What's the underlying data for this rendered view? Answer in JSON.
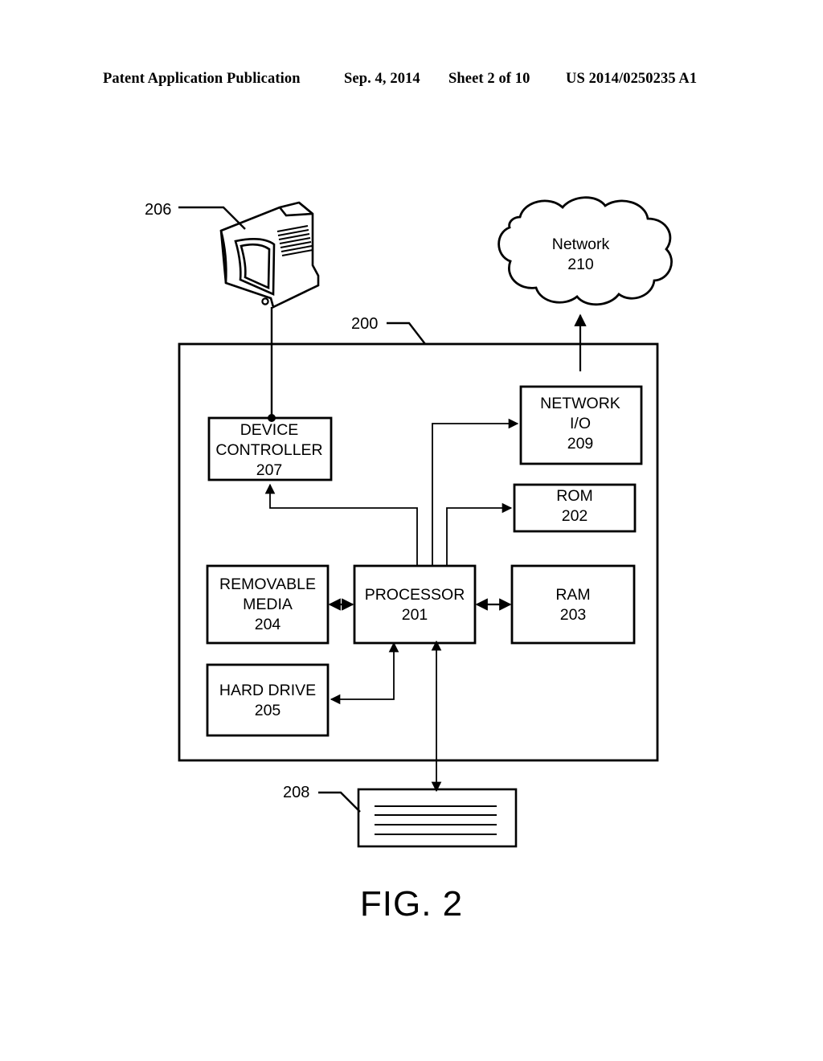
{
  "header": {
    "publication": "Patent Application Publication",
    "date": "Sep. 4, 2014",
    "sheet": "Sheet 2 of 10",
    "patent_number": "US 2014/0250235 A1"
  },
  "figure": {
    "caption": "FIG. 2",
    "system_ref": "200",
    "display_ref": "206",
    "input_device_ref": "208",
    "cloud": {
      "name": "Network",
      "ref": "210",
      "label": "Network\n210"
    },
    "blocks": [
      {
        "id": "device-controller",
        "name": "DEVICE CONTROLLER",
        "ref": "207",
        "label": "DEVICE\nCONTROLLER\n207"
      },
      {
        "id": "network-io",
        "name": "NETWORK I/O",
        "ref": "209",
        "label": "NETWORK\nI/O\n209"
      },
      {
        "id": "rom",
        "name": "ROM",
        "ref": "202",
        "label": "ROM\n202"
      },
      {
        "id": "removable-media",
        "name": "REMOVABLE MEDIA",
        "ref": "204",
        "label": "REMOVABLE\nMEDIA\n204"
      },
      {
        "id": "processor",
        "name": "PROCESSOR",
        "ref": "201",
        "label": "PROCESSOR\n201"
      },
      {
        "id": "ram",
        "name": "RAM",
        "ref": "203",
        "label": "RAM\n203"
      },
      {
        "id": "hard-drive",
        "name": "HARD DRIVE",
        "ref": "205",
        "label": "HARD DRIVE\n205"
      }
    ]
  },
  "colors": {
    "ink": "#000000",
    "paper": "#ffffff"
  }
}
